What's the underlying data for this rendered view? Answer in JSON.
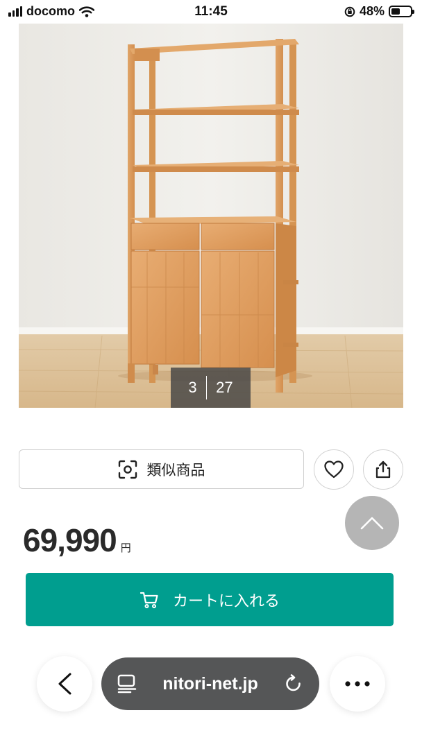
{
  "status_bar": {
    "carrier": "docomo",
    "time": "11:45",
    "battery": "48%",
    "battery_level": 0.48
  },
  "product": {
    "image_icon": "wooden-shelf-cabinet-photo",
    "image_counter": {
      "current": "3",
      "total": "27"
    }
  },
  "actions": {
    "similar_label": "類似商品",
    "similar_icon": "camera-scan-icon",
    "favorite_icon": "heart-icon",
    "share_icon": "share-icon",
    "scroll_top_icon": "chevron-up-icon"
  },
  "price": {
    "value": "69,990",
    "unit": "円"
  },
  "cart": {
    "label": "カートに入れる",
    "icon": "cart-icon",
    "color": "#009e8f"
  },
  "browser": {
    "url": "nitori-net.jp",
    "back_icon": "chevron-left-icon",
    "page_icon": "page-settings-icon",
    "reload_icon": "reload-icon",
    "more_icon": "more-icon"
  }
}
